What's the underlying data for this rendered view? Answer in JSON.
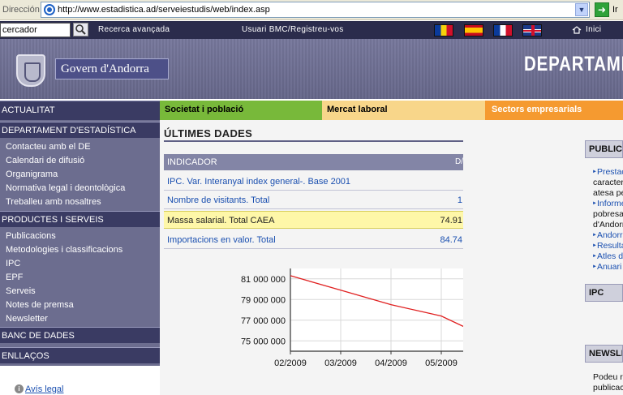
{
  "address_bar": {
    "label": "Dirección",
    "url": "http://www.estadistica.ad/serveiestudis/web/index.asp",
    "go_label": "Ir"
  },
  "toolbar": {
    "search_value": "cercador",
    "advanced_search": "Recerca avançada",
    "user_link": "Usuari BMC/Registreu-vos",
    "home_label": "Inici",
    "flags": [
      "andorra-flag",
      "spain-flag",
      "france-flag",
      "uk-flag"
    ]
  },
  "header": {
    "govern": "Govern d'Andorra",
    "department": "DEPARTAME"
  },
  "tabs": {
    "actualitat": "ACTUALITAT",
    "societat": "Societat i població",
    "mercat": "Mercat laboral",
    "sectors": "Sectors empresarials"
  },
  "sidebar": {
    "departament": {
      "heading": "DEPARTAMENT D'ESTADÍSTICA",
      "items": [
        "Contacteu amb el DE",
        "Calendari de difusió",
        "Organigrama",
        "Normativa legal i deontològica",
        "Treballeu amb nosaltres"
      ]
    },
    "productes": {
      "heading": "PRODUCTES I SERVEIS",
      "items": [
        "Publicacions",
        "Metodologies i classificacions",
        "IPC",
        "EPF",
        "Serveis",
        "Notes de premsa",
        "Newsletter"
      ]
    },
    "banc": "BANC DE DADES",
    "enllacos": "ENLLAÇOS",
    "avis_legal": "Avís legal"
  },
  "main": {
    "title": "ÚLTIMES DADES",
    "table_header": "INDICADOR",
    "table_header_col2": "D/",
    "rows": [
      {
        "label": "IPC. Var. Interanyal index general-. Base 2001",
        "value": ""
      },
      {
        "label": "Nombre de visitants. Total",
        "value": "1"
      },
      {
        "label": "Massa salarial. Total CAEA",
        "value": "74.91"
      },
      {
        "label": "Importacions en valor. Total",
        "value": "84.74"
      }
    ]
  },
  "chart_data": {
    "type": "line",
    "x": [
      "02/2009",
      "03/2009",
      "04/2009",
      "05/2009",
      ""
    ],
    "categories": [
      "02/2009",
      "03/2009",
      "04/2009",
      "05/2009"
    ],
    "yticks": [
      "81 000 000",
      "79 000 000",
      "77 000 000",
      "75 000 000"
    ],
    "ylim": [
      74000000,
      82000000
    ],
    "series": [
      {
        "values": [
          81300000,
          79900000,
          78500000,
          77400000,
          76400000
        ]
      }
    ],
    "line_color": "#e02020",
    "grid": true
  },
  "right_column": {
    "publications_head": "PUBLICACIONS",
    "links": [
      "Prestacions",
      "característiques",
      "atesa per",
      "Informe",
      "pobresa",
      "d'Andorra",
      "Andorra",
      "Resultats",
      "Atles de",
      "Anuari"
    ],
    "ipc_head": "IPC",
    "newsletter_head": "NEWSLETTER",
    "newsletter_text": [
      "Podeu rebre",
      "publicacions"
    ]
  }
}
